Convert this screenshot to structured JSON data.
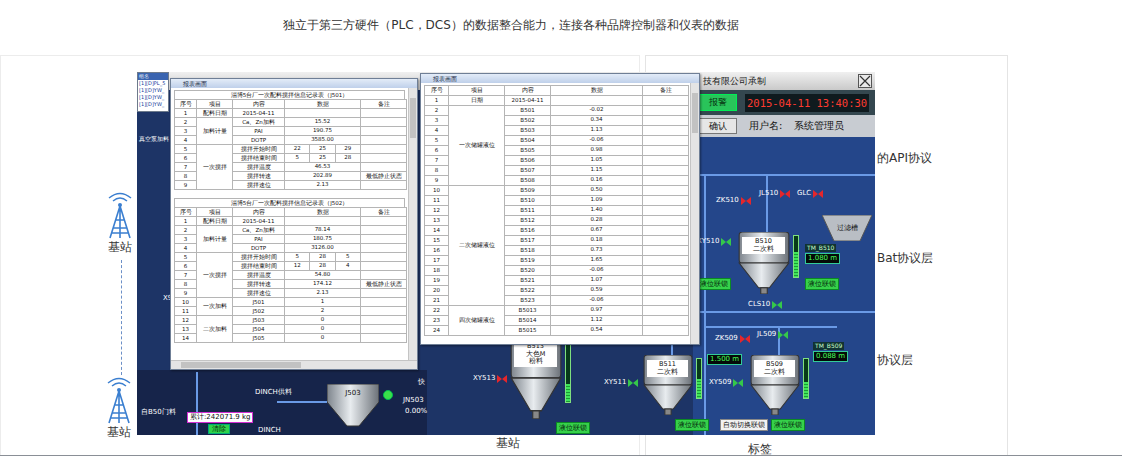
{
  "caption": "独立于第三方硬件（PLC，DCS）的数据整合能力，连接各种品牌控制器和仪表的数据",
  "diagram": {
    "stations": [
      "基站",
      "基站",
      "基站"
    ],
    "card_lines": [
      "的API协议",
      "Bat协议层",
      "协议层"
    ],
    "bottom_label": "标签"
  },
  "scada": {
    "title": "技有限公司承制",
    "alarm_button": "报警",
    "datetime": "2015-04-11 13:40:30",
    "confirm_button": "确认",
    "user_label": "用户名:",
    "user_name": "系统管理员",
    "tree": {
      "header": "组名",
      "items": [
        "[1][D]PL_5",
        "[1][D]YW_",
        "[1][D]YW_",
        "[1][D]YW_"
      ]
    },
    "labels": [
      "真空泵加料",
      "X9",
      "DINCH供料",
      "快",
      "JN503",
      "0.00%",
      "自B50门料",
      "DINCH"
    ],
    "filter": "过滤槽",
    "hopper": "J503",
    "totalizer": "累计:242071.9 kg",
    "clear_button": "清除",
    "tanks": [
      {
        "lines": [
          "B510",
          "二次料"
        ],
        "level": 0.6
      },
      {
        "lines": [
          "B513",
          "大色M",
          "粉料"
        ],
        "level": 0.3
      },
      {
        "lines": [
          "B511",
          "二次料"
        ],
        "level": 0.5
      },
      {
        "lines": [
          "B509",
          "二次料"
        ],
        "level": 0.4
      }
    ],
    "valves": [
      {
        "tag": "ZK510",
        "open": false
      },
      {
        "tag": "JL510",
        "open": false
      },
      {
        "tag": "GLC",
        "open": false
      },
      {
        "tag": "XY510",
        "open": true
      },
      {
        "tag": "CLS10",
        "open": true
      },
      {
        "tag": "ZK509",
        "open": false
      },
      {
        "tag": "JL509",
        "open": true
      },
      {
        "tag": "XY509",
        "open": true
      },
      {
        "tag": "XY511",
        "open": true
      },
      {
        "tag": "XY513",
        "open": false
      }
    ],
    "interlocks": [
      {
        "text": "液位联锁",
        "kind": "lock"
      },
      {
        "text": "液位联锁",
        "kind": "lock"
      },
      {
        "text": "液位联锁",
        "kind": "lock"
      },
      {
        "text": "自动切换联锁",
        "kind": "auto"
      },
      {
        "text": "液位联锁",
        "kind": "lock"
      },
      {
        "text": "液位联锁",
        "kind": "lock"
      }
    ],
    "readouts": [
      {
        "tag": "TM_B510",
        "value": "1.080 m"
      },
      {
        "tag": "TM_B509",
        "value": "0.088 m"
      },
      {
        "value": "1.500 m"
      }
    ]
  },
  "reports": [
    {
      "title": "报表画面",
      "horizontal_scrollbar": true,
      "tables": [
        {
          "title": "淄博5台厂一次配料搅拌信息记录表（J501）",
          "columns": [
            "序号",
            "项目",
            "内容",
            "数据",
            "备注"
          ],
          "groups": [
            {
              "item": "配料日期",
              "rows": [
                {
                  "no": "1",
                  "content": "2015-04-11",
                  "data": []
                }
              ]
            },
            {
              "item": "加料计量",
              "rows": [
                {
                  "no": "2",
                  "content": "Ca、Zn加料",
                  "data": [
                    "15.52"
                  ]
                },
                {
                  "no": "3",
                  "content": "PAI",
                  "data": [
                    "190.75"
                  ]
                },
                {
                  "no": "4",
                  "content": "DOTP",
                  "data": [
                    "3585.00"
                  ]
                }
              ]
            },
            {
              "item": "一次搅拌",
              "rows": [
                {
                  "no": "5",
                  "content": "搅拌开始时间",
                  "data": [
                    "22",
                    "25",
                    "29"
                  ]
                },
                {
                  "no": "6",
                  "content": "搅拌结束时间",
                  "data": [
                    "5",
                    "25",
                    "28"
                  ]
                },
                {
                  "no": "7",
                  "content": "搅拌温度",
                  "data": [
                    "46.53"
                  ]
                },
                {
                  "no": "8",
                  "content": "搅拌转速",
                  "data": [
                    "202.89"
                  ],
                  "note": "最低静止状态"
                },
                {
                  "no": "9",
                  "content": "搅拌速位",
                  "data": [
                    "2.13"
                  ]
                }
              ]
            }
          ]
        },
        {
          "title": "淄博5台厂一次配料搅拌信息记录表（J502）",
          "columns": [
            "序号",
            "项目",
            "内容",
            "数据",
            "备注"
          ],
          "groups": [
            {
              "item": "配料日期",
              "rows": [
                {
                  "no": "1",
                  "content": "2015-04-11",
                  "data": []
                }
              ]
            },
            {
              "item": "加料计量",
              "rows": [
                {
                  "no": "2",
                  "content": "Ca、Zn加料",
                  "data": [
                    "78.14"
                  ]
                },
                {
                  "no": "3",
                  "content": "PAI",
                  "data": [
                    "180.75"
                  ]
                },
                {
                  "no": "4",
                  "content": "DOTP",
                  "data": [
                    "3126.00"
                  ]
                }
              ]
            },
            {
              "item": "一次搅拌",
              "rows": [
                {
                  "no": "5",
                  "content": "搅拌开始时间",
                  "data": [
                    "5",
                    "28",
                    "5"
                  ]
                },
                {
                  "no": "6",
                  "content": "搅拌结束时间",
                  "data": [
                    "12",
                    "28",
                    "4"
                  ]
                },
                {
                  "no": "7",
                  "content": "搅拌温度",
                  "data": [
                    "54.80"
                  ]
                },
                {
                  "no": "8",
                  "content": "搅拌转速",
                  "data": [
                    "174.12"
                  ],
                  "note": "最低静止状态"
                },
                {
                  "no": "9",
                  "content": "搅拌速位",
                  "data": [
                    "2.13"
                  ]
                }
              ]
            },
            {
              "item": "一次加料",
              "rows": [
                {
                  "no": "10",
                  "content": "J501",
                  "data": [
                    "1"
                  ]
                },
                {
                  "no": "11",
                  "content": "J502",
                  "data": [
                    "2"
                  ]
                }
              ]
            },
            {
              "item": "二次加料",
              "rows": [
                {
                  "no": "12",
                  "content": "J503",
                  "data": [
                    "0"
                  ]
                },
                {
                  "no": "13",
                  "content": "J504",
                  "data": [
                    "0"
                  ]
                },
                {
                  "no": "14",
                  "content": "J505",
                  "data": [
                    "0"
                  ]
                }
              ]
            }
          ]
        }
      ]
    },
    {
      "title": "报表画面",
      "horizontal_scrollbar": false,
      "tables": [
        {
          "columns": [
            "序号",
            "项目",
            "内容",
            "数据",
            "备注"
          ],
          "groups": [
            {
              "item": "日期",
              "rows": [
                {
                  "no": "1",
                  "content": "2015-04-11",
                  "data": []
                }
              ]
            },
            {
              "item": "一次储罐液位",
              "rows": [
                {
                  "no": "2",
                  "content": "B501",
                  "data": [
                    "-0.02"
                  ]
                },
                {
                  "no": "3",
                  "content": "B502",
                  "data": [
                    "0.34"
                  ]
                },
                {
                  "no": "4",
                  "content": "B503",
                  "data": [
                    "1.13"
                  ]
                },
                {
                  "no": "5",
                  "content": "B504",
                  "data": [
                    "-0.06"
                  ]
                },
                {
                  "no": "6",
                  "content": "B505",
                  "data": [
                    "0.98"
                  ]
                },
                {
                  "no": "7",
                  "content": "B506",
                  "data": [
                    "1.05"
                  ]
                },
                {
                  "no": "8",
                  "content": "B507",
                  "data": [
                    "1.15"
                  ]
                },
                {
                  "no": "9",
                  "content": "B508",
                  "data": [
                    "0.16"
                  ]
                }
              ]
            },
            {
              "item": "二次储罐液位",
              "rows": [
                {
                  "no": "10",
                  "content": "B509",
                  "data": [
                    "0.50"
                  ]
                },
                {
                  "no": "11",
                  "content": "B510",
                  "data": [
                    "1.09"
                  ]
                },
                {
                  "no": "12",
                  "content": "B511",
                  "data": [
                    "1.40"
                  ]
                },
                {
                  "no": "13",
                  "content": "B512",
                  "data": [
                    "0.28"
                  ]
                },
                {
                  "no": "14",
                  "content": "B516",
                  "data": [
                    "0.67"
                  ]
                },
                {
                  "no": "15",
                  "content": "B517",
                  "data": [
                    "0.18"
                  ]
                },
                {
                  "no": "16",
                  "content": "B518",
                  "data": [
                    "0.73"
                  ]
                },
                {
                  "no": "17",
                  "content": "B519",
                  "data": [
                    "1.65"
                  ]
                },
                {
                  "no": "18",
                  "content": "B520",
                  "data": [
                    "-0.06"
                  ]
                },
                {
                  "no": "19",
                  "content": "B521",
                  "data": [
                    "1.07"
                  ]
                },
                {
                  "no": "20",
                  "content": "B522",
                  "data": [
                    "0.59"
                  ]
                },
                {
                  "no": "21",
                  "content": "B523",
                  "data": [
                    "-0.06"
                  ]
                }
              ]
            },
            {
              "item": "四次储罐液位",
              "rows": [
                {
                  "no": "22",
                  "content": "B5013",
                  "data": [
                    "0.97"
                  ]
                },
                {
                  "no": "23",
                  "content": "B5014",
                  "data": [
                    "1.12"
                  ]
                },
                {
                  "no": "24",
                  "content": "B5015",
                  "data": [
                    "0.54"
                  ]
                }
              ]
            }
          ]
        }
      ]
    }
  ]
}
